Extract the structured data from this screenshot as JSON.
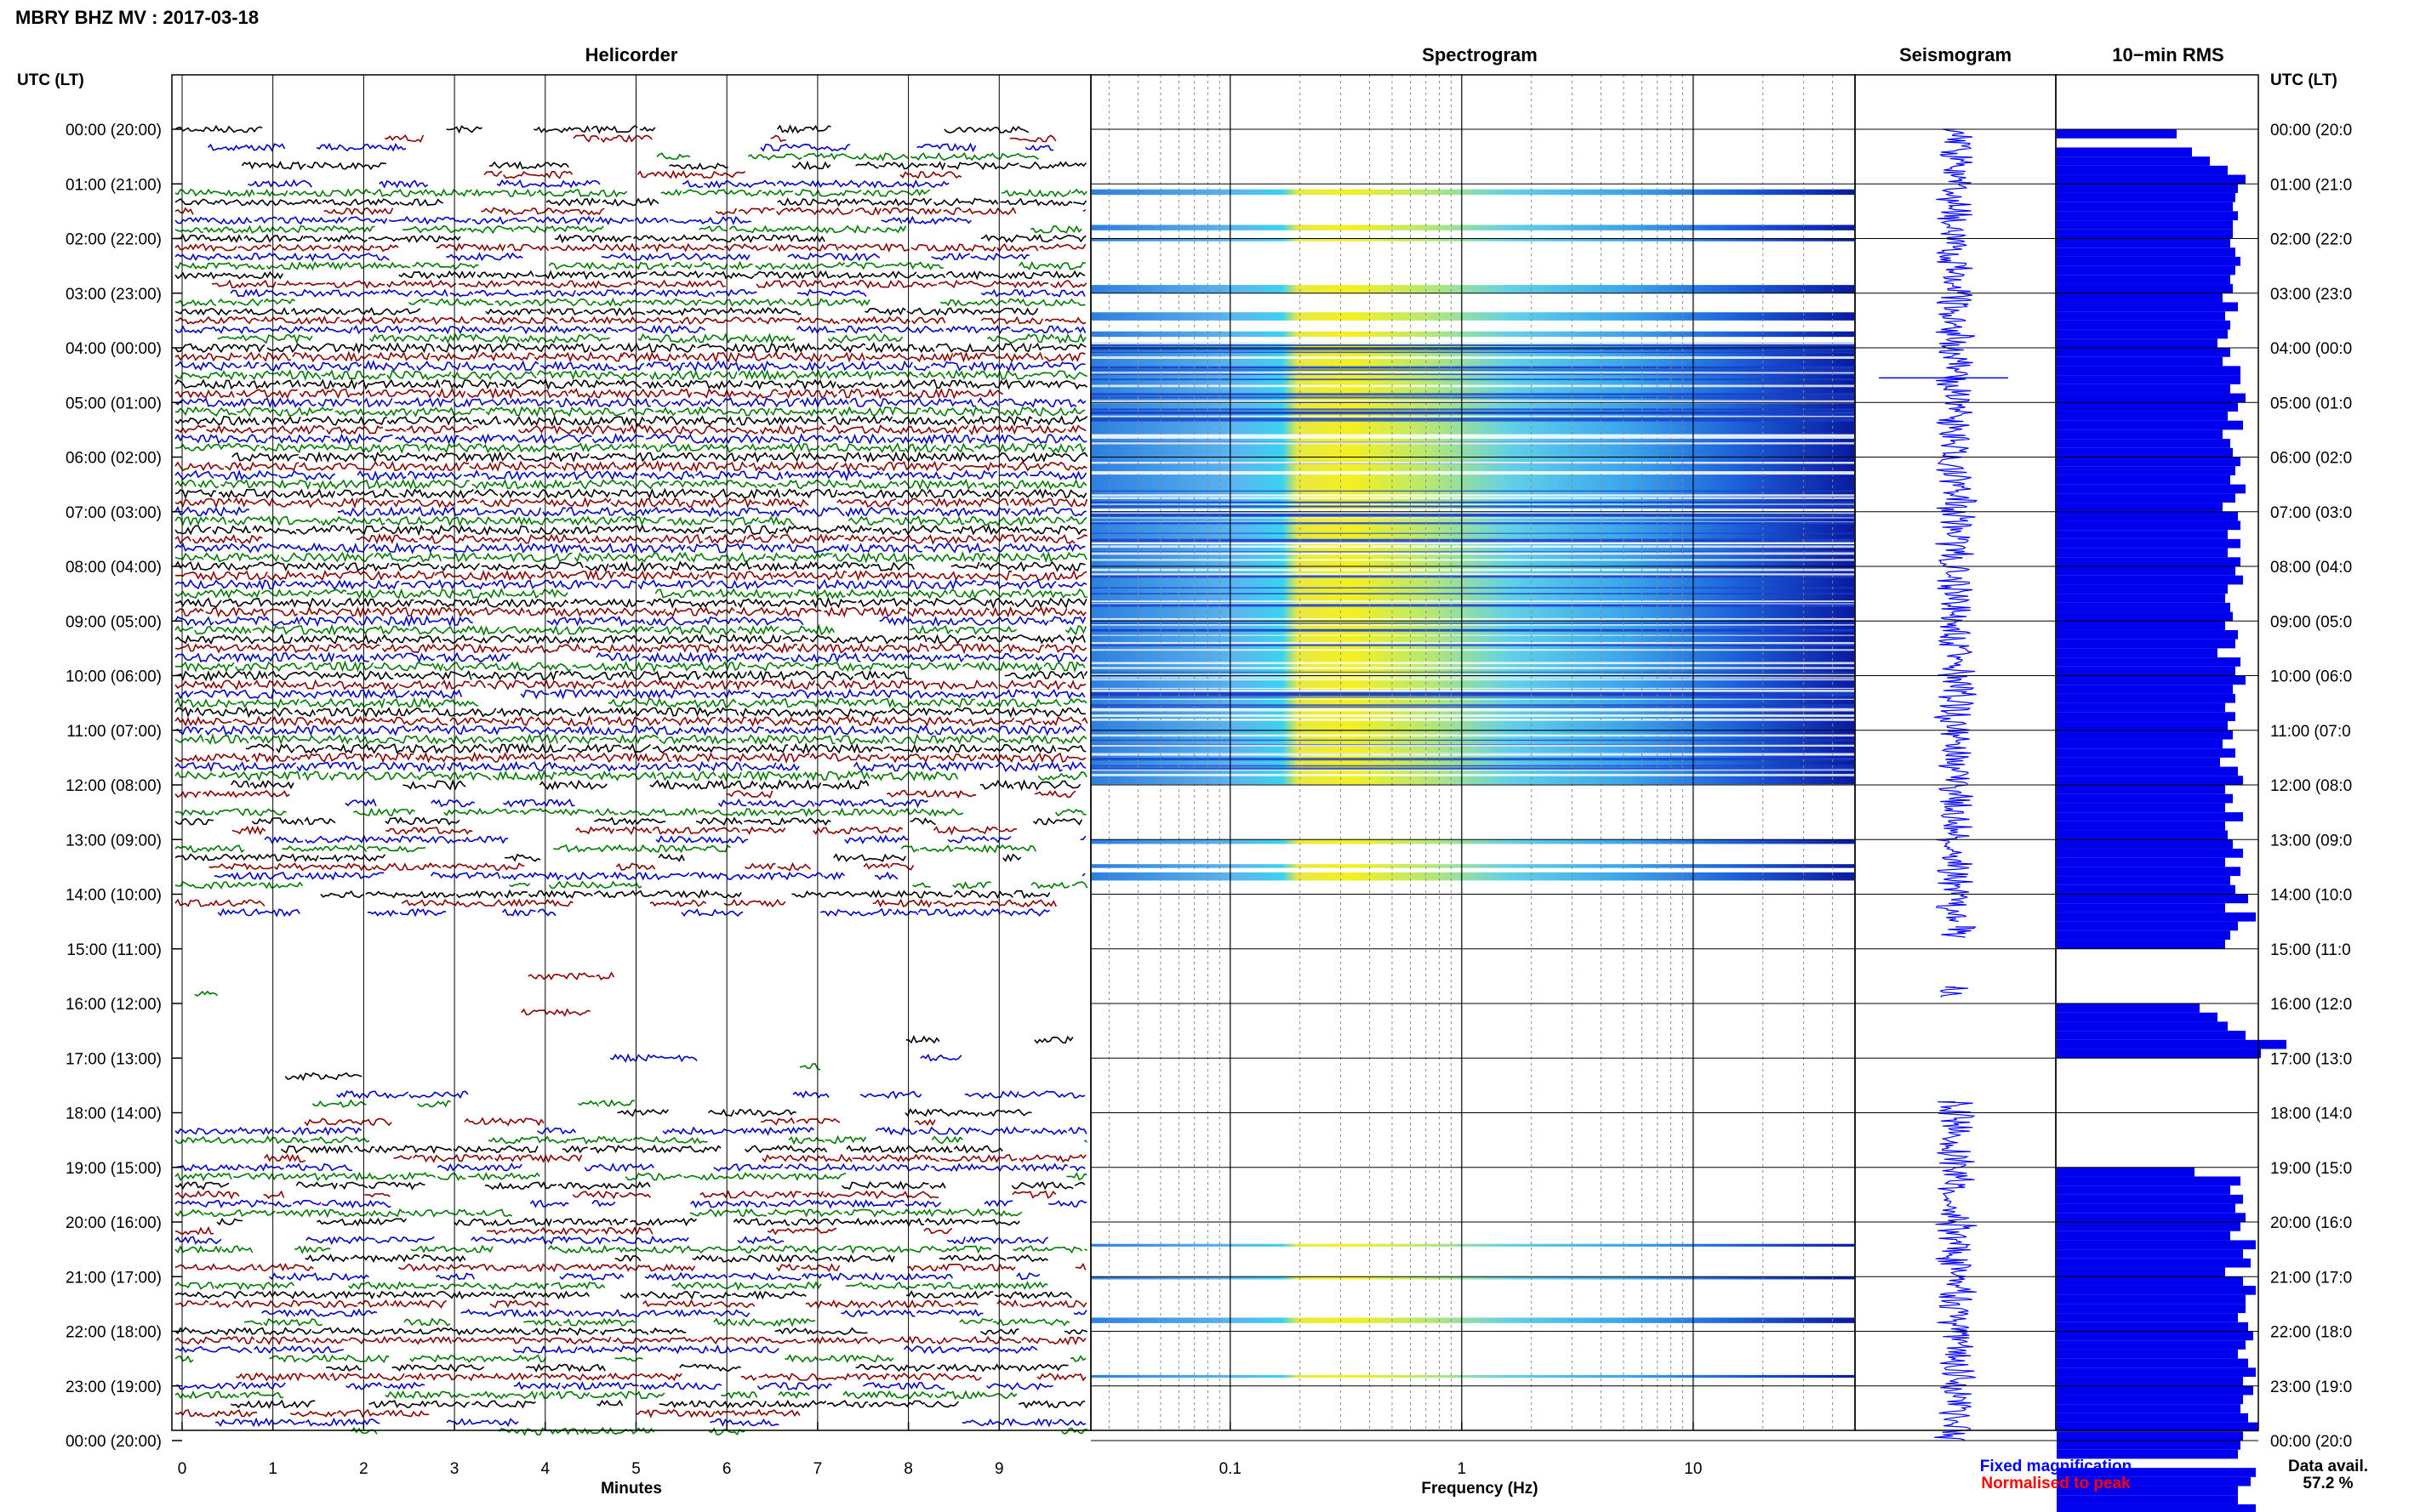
{
  "header": {
    "title": "MBRY BHZ MV : 2017-03-18"
  },
  "panels": {
    "helicorder": "Helicorder",
    "spectrogram": "Spectrogram",
    "seismogram": "Seismogram",
    "rms": "10−min RMS"
  },
  "axes": {
    "time_header": "UTC (LT)",
    "minutes_label": "Minutes",
    "frequency_label": "Frequency (Hz)"
  },
  "legend": {
    "fixed": "Fixed magnification",
    "normalised": "Normalised to peak",
    "fixed_color": "#0000ff",
    "normalised_color": "#ff0000"
  },
  "availability": {
    "label": "Data avail.",
    "value": "57.2 %"
  },
  "colors": {
    "trace_cycle": [
      "#000000",
      "#8b0000",
      "#0000cc",
      "#007a00"
    ],
    "rms_bar": "#0000ee",
    "seismogram": "#0000ff"
  },
  "chart_data": [
    {
      "type": "heatmap",
      "title": "Helicorder",
      "xlabel": "Minutes",
      "ylabel": "UTC (LT)",
      "x_ticks": [
        "0",
        "1",
        "2",
        "3",
        "4",
        "5",
        "6",
        "7",
        "8",
        "9"
      ],
      "xlim": [
        0,
        10
      ],
      "y_ticks": [
        "00:00 (20:00)",
        "01:00 (21:00)",
        "02:00 (22:00)",
        "03:00 (23:00)",
        "04:00 (00:00)",
        "05:00 (01:00)",
        "06:00 (02:00)",
        "07:00 (03:00)",
        "08:00 (04:00)",
        "09:00 (05:00)",
        "10:00 (06:00)",
        "11:00 (07:00)",
        "12:00 (08:00)",
        "13:00 (09:00)",
        "14:00 (10:00)",
        "15:00 (11:00)",
        "16:00 (12:00)",
        "17:00 (13:00)",
        "18:00 (14:00)",
        "19:00 (15:00)",
        "20:00 (16:00)",
        "21:00 (17:00)",
        "22:00 (18:00)",
        "23:00 (19:00)",
        "00:00 (20:00)"
      ],
      "y_ticks_right": [
        "00:00 (20:0",
        "01:00 (21:0",
        "02:00 (22:0",
        "03:00 (23:0",
        "04:00 (00:0",
        "05:00 (01:0",
        "06:00 (02:0",
        "07:00 (03:0",
        "08:00 (04:0",
        "09:00 (05:0",
        "10:00 (06:0",
        "11:00 (07:0",
        "12:00 (08:0",
        "13:00 (09:0",
        "14:00 (10:0",
        "15:00 (11:0",
        "16:00 (12:0",
        "17:00 (13:0",
        "18:00 (14:0",
        "19:00 (15:0",
        "20:00 (16:0",
        "21:00 (17:0",
        "22:00 (18:0",
        "23:00 (19:0",
        "00:00 (20:0"
      ],
      "ylim_hours": [
        0,
        24
      ]
    },
    {
      "type": "heatmap",
      "title": "Spectrogram",
      "xlabel": "Frequency (Hz)",
      "x_scale": "log",
      "xlim": [
        0.025,
        50
      ],
      "x_ticks": [
        "0.1",
        "1",
        "10"
      ],
      "ylim_hours": [
        0,
        24
      ],
      "data_present_hours": [
        [
          1.1,
          1.2
        ],
        [
          1.75,
          1.85
        ],
        [
          2.0,
          2.05
        ],
        [
          2.85,
          3.0
        ],
        [
          3.35,
          3.5
        ],
        [
          3.7,
          3.8
        ],
        [
          3.9,
          12.0
        ],
        [
          13.0,
          13.08
        ],
        [
          13.45,
          13.52
        ],
        [
          13.6,
          13.75
        ],
        [
          20.4,
          20.45
        ],
        [
          21.0,
          21.05
        ],
        [
          21.75,
          21.85
        ],
        [
          22.8,
          22.85
        ]
      ]
    },
    {
      "type": "line",
      "title": "Seismogram",
      "ylim_hours": [
        0,
        24
      ],
      "data_present_hours": [
        [
          0,
          14.5
        ],
        [
          14.6,
          14.8
        ],
        [
          15.7,
          15.9
        ],
        [
          17.8,
          24
        ]
      ],
      "spike_hour": 4.55,
      "legend": [
        "Fixed magnification",
        "Normalised to peak"
      ]
    },
    {
      "type": "bar",
      "title": "10−min RMS",
      "orientation": "horizontal",
      "ylim_hours": [
        0,
        24
      ],
      "bin_minutes": 10,
      "rms_relative": [
        0.47,
        0.0,
        0.53,
        0.6,
        0.67,
        0.74,
        0.71,
        0.7,
        0.69,
        0.71,
        0.69,
        0.69,
        0.68,
        0.7,
        0.72,
        0.7,
        0.68,
        0.69,
        0.65,
        0.71,
        0.66,
        0.68,
        0.67,
        0.63,
        0.68,
        0.65,
        0.72,
        0.72,
        0.68,
        0.74,
        0.71,
        0.67,
        0.73,
        0.65,
        0.68,
        0.69,
        0.72,
        0.7,
        0.68,
        0.74,
        0.7,
        0.65,
        0.71,
        0.72,
        0.67,
        0.72,
        0.67,
        0.72,
        0.7,
        0.73,
        0.67,
        0.66,
        0.68,
        0.69,
        0.66,
        0.71,
        0.7,
        0.63,
        0.72,
        0.7,
        0.74,
        0.69,
        0.7,
        0.66,
        0.7,
        0.67,
        0.69,
        0.65,
        0.7,
        0.64,
        0.71,
        0.73,
        0.66,
        0.69,
        0.66,
        0.73,
        0.66,
        0.67,
        0.69,
        0.73,
        0.66,
        0.72,
        0.68,
        0.7,
        0.75,
        0.66,
        0.78,
        0.71,
        0.68,
        0.66,
        0.0,
        0.0,
        0.0,
        0.0,
        0.0,
        0.0,
        0.56,
        0.63,
        0.67,
        0.74,
        0.9,
        0.8,
        0.0,
        0.0,
        0.0,
        0.0,
        0.0,
        0.0,
        0.0,
        0.0,
        0.0,
        0.0,
        0.0,
        0.0,
        0.54,
        0.72,
        0.68,
        0.73,
        0.7,
        0.74,
        0.72,
        0.68,
        0.78,
        0.73,
        0.76,
        0.66,
        0.73,
        0.78,
        0.74,
        0.74,
        0.71,
        0.75,
        0.77,
        0.74,
        0.71,
        0.75,
        0.78,
        0.73,
        0.77,
        0.73,
        0.72,
        0.75,
        0.79,
        0.73,
        0.72,
        0.71,
        0.0,
        0.78,
        0.76,
        0.71,
        0.71,
        0.78,
        0.8
      ]
    }
  ]
}
